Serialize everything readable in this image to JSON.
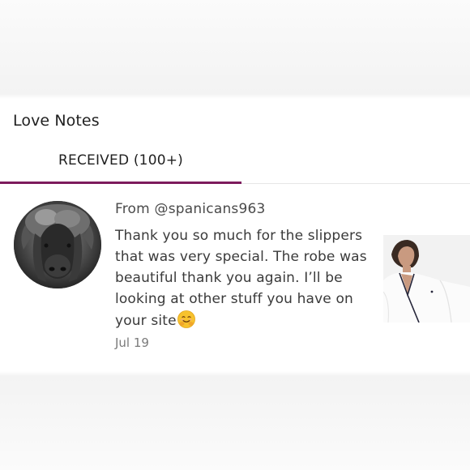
{
  "section": {
    "title": "Love Notes"
  },
  "tabs": [
    {
      "label": "RECEIVED (100+)",
      "active": true
    }
  ],
  "colors": {
    "accent": "#7d1b5d"
  },
  "note": {
    "from": "From @spanicans963",
    "message": "Thank you so much for the slippers that was very special. The robe was beautiful thank you again. I’ll be looking at other stuff you have on your site",
    "emoji": "smiling-face-with-open-hands-emoji",
    "date": "Jul 19",
    "avatar": "bison-avatar",
    "thumbnail": "white-robe-product-image"
  }
}
